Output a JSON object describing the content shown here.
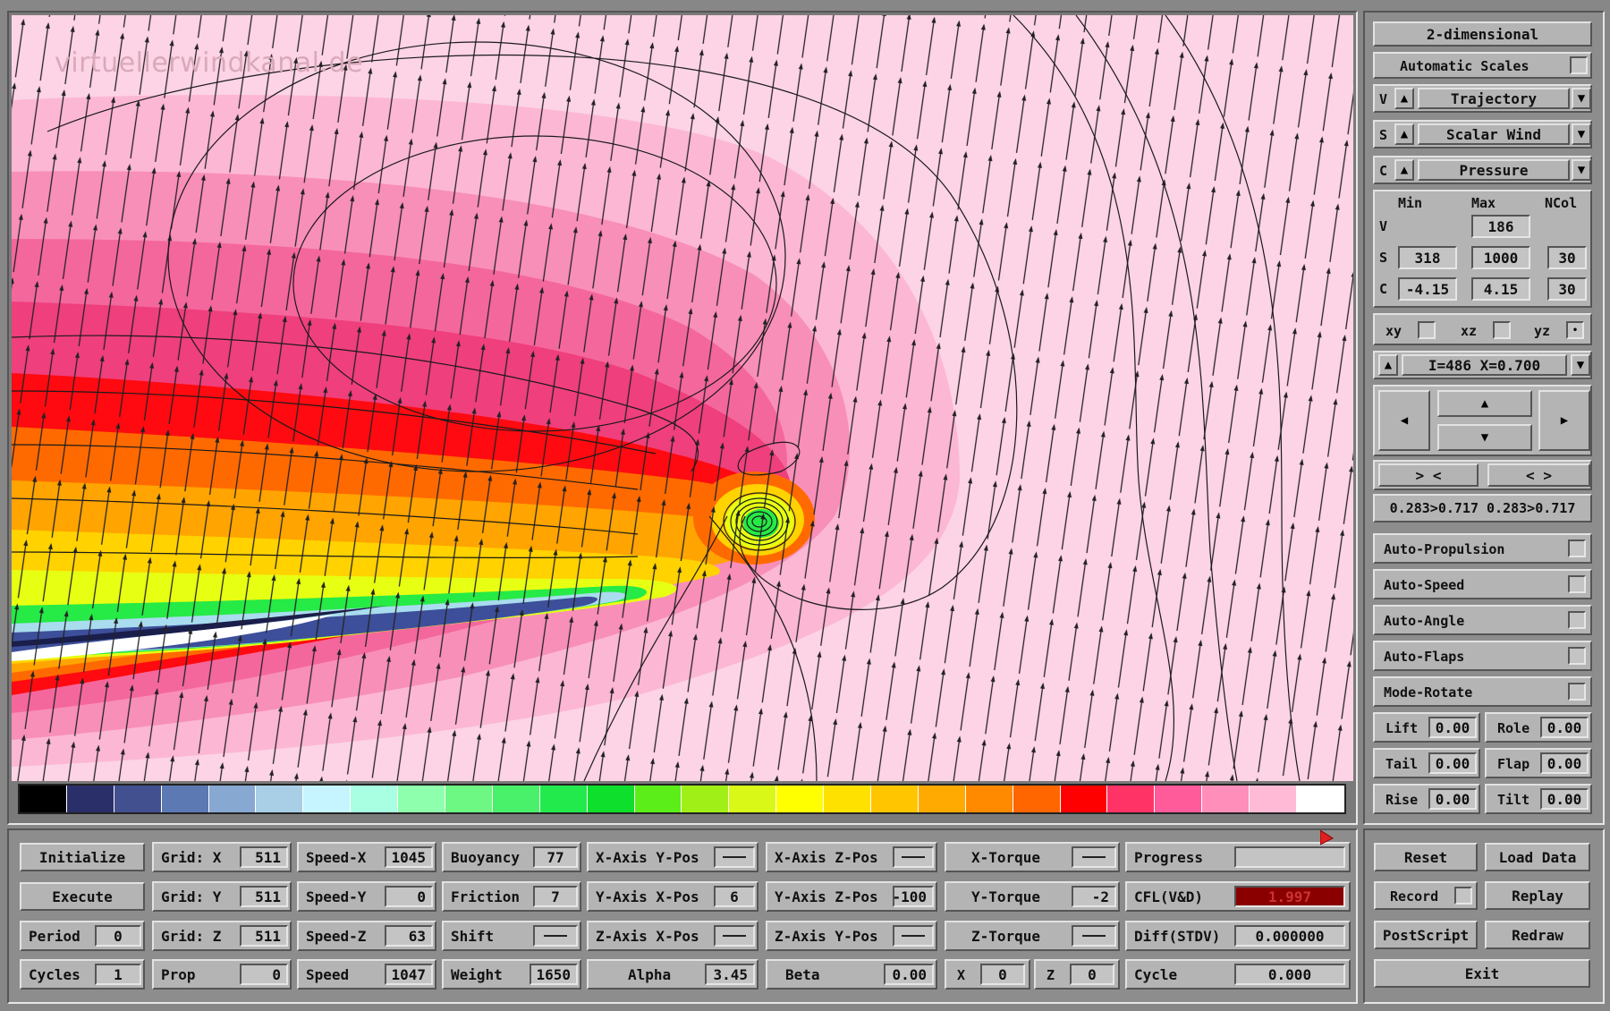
{
  "watermark": "virtuellerwindkanal.de",
  "colors": {
    "colorbar": [
      "#000000",
      "#2a2f6a",
      "#43508f",
      "#5d79b3",
      "#86a8d1",
      "#a8cfe6",
      "#c6f5ff",
      "#a8ffe1",
      "#8effad",
      "#6cf883",
      "#49f06a",
      "#22ea4c",
      "#0ede2c",
      "#5cee18",
      "#a0f018",
      "#d9f818",
      "#ffff00",
      "#ffe100",
      "#ffc600",
      "#ffaa00",
      "#ff8a00",
      "#ff6600",
      "#ff0000",
      "#ff3366",
      "#ff5a99",
      "#ff8fba",
      "#ffbad6",
      "#ffffff"
    ],
    "bg_light": "#fdd3e6"
  },
  "right_panel": {
    "mode_button": "2-dimensional",
    "auto_scales": "Automatic Scales",
    "selectors": [
      {
        "prefix": "V",
        "value": "Trajectory"
      },
      {
        "prefix": "S",
        "value": "Scalar Wind"
      },
      {
        "prefix": "C",
        "value": "Pressure"
      }
    ],
    "range_headers": {
      "min": "Min",
      "max": "Max",
      "ncol": "NCol"
    },
    "ranges": [
      {
        "label": "V",
        "min": "",
        "max": "186",
        "ncol": ""
      },
      {
        "label": "S",
        "min": "318",
        "max": "1000",
        "ncol": "30"
      },
      {
        "label": "C",
        "min": "-4.15",
        "max": "4.15",
        "ncol": "30"
      }
    ],
    "planes": [
      "xy",
      "xz",
      "yz"
    ],
    "slice": "I=486  X=0.700",
    "zoom_in": "> <",
    "zoom_out": "< >",
    "range_text": "0.283>0.717 0.283>0.717",
    "toggles": [
      "Auto-Propulsion",
      "Auto-Speed",
      "Auto-Angle",
      "Auto-Flaps",
      "Mode-Rotate"
    ],
    "controls": [
      {
        "label": "Lift",
        "value": "0.00"
      },
      {
        "label": "Role",
        "value": "0.00"
      },
      {
        "label": "Tail",
        "value": "0.00"
      },
      {
        "label": "Flap",
        "value": "0.00"
      },
      {
        "label": "Rise",
        "value": "0.00"
      },
      {
        "label": "Tilt",
        "value": "0.00"
      }
    ],
    "buttons": {
      "reset": "Reset",
      "load": "Load Data",
      "record": "Record",
      "replay": "Replay",
      "postscript": "PostScript",
      "redraw": "Redraw",
      "exit": "Exit"
    }
  },
  "bottom": {
    "initialize": "Initialize",
    "execute": "Execute",
    "period": {
      "label": "Period",
      "value": "0"
    },
    "cycles": {
      "label": "Cycles",
      "value": "1"
    },
    "grid_x": {
      "label": "Grid: X",
      "value": "511"
    },
    "grid_y": {
      "label": "Grid: Y",
      "value": "511"
    },
    "grid_z": {
      "label": "Grid: Z",
      "value": "511"
    },
    "prop": {
      "label": "Prop",
      "value": "0"
    },
    "speed_x": {
      "label": "Speed-X",
      "value": "1045"
    },
    "speed_y": {
      "label": "Speed-Y",
      "value": "0"
    },
    "speed_z": {
      "label": "Speed-Z",
      "value": "63"
    },
    "speed": {
      "label": "Speed",
      "value": "1047"
    },
    "buoyancy": {
      "label": "Buoyancy",
      "value": "77"
    },
    "friction": {
      "label": "Friction",
      "value": "7"
    },
    "shift": {
      "label": "Shift",
      "value": ""
    },
    "weight": {
      "label": "Weight",
      "value": "1650"
    },
    "xaxis_ypos": {
      "label": "X-Axis Y-Pos",
      "value": ""
    },
    "yaxis_xpos": {
      "label": "Y-Axis X-Pos",
      "value": "6"
    },
    "zaxis_xpos": {
      "label": "Z-Axis X-Pos",
      "value": ""
    },
    "alpha": {
      "label": "Alpha",
      "value": "3.45"
    },
    "xaxis_zpos": {
      "label": "X-Axis Z-Pos",
      "value": ""
    },
    "yaxis_zpos": {
      "label": "Y-Axis Z-Pos",
      "value": "-100"
    },
    "zaxis_ypos": {
      "label": "Z-Axis Y-Pos",
      "value": ""
    },
    "beta": {
      "label": "Beta",
      "value": "0.00"
    },
    "x_torque": {
      "label": "X-Torque",
      "value": ""
    },
    "y_torque": {
      "label": "Y-Torque",
      "value": "-2"
    },
    "z_torque": {
      "label": "Z-Torque",
      "value": ""
    },
    "x_field": {
      "label": "X",
      "value": "0"
    },
    "z_field": {
      "label": "Z",
      "value": "0"
    },
    "progress": {
      "label": "Progress",
      "value": ""
    },
    "cfl": {
      "label": "CFL(V&D)",
      "value": "1.997"
    },
    "diff": {
      "label": "Diff(STDV)",
      "value": "0.000000"
    },
    "cycle": {
      "label": "Cycle",
      "value": "0.000"
    }
  }
}
